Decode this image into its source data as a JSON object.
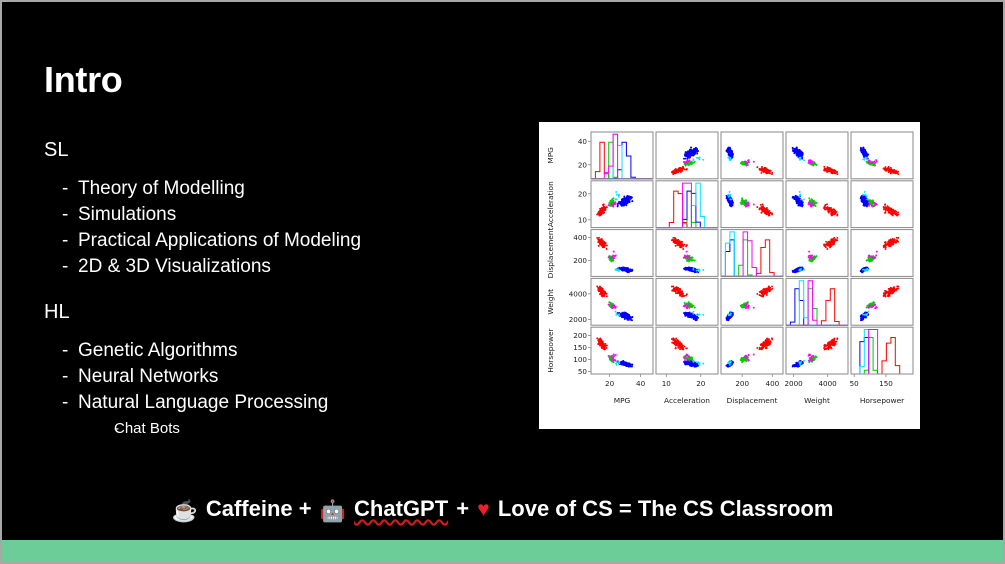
{
  "slide": {
    "title": "Intro",
    "background_color": "#000000",
    "text_color": "#ffffff",
    "accent_strip_color": "#6ccd99",
    "border_color": "#a8a8a8"
  },
  "sections": [
    {
      "label": "SL",
      "items": [
        "Theory of Modelling",
        "Simulations",
        "Practical Applications of Modeling",
        "2D & 3D Visualizations"
      ]
    },
    {
      "label": "HL",
      "items": [
        "Genetic Algorithms",
        "Neural Networks",
        "Natural Language Processing"
      ],
      "sub_items": [
        "Chat Bots"
      ]
    }
  ],
  "bullet_marker": "-",
  "footer": {
    "coffee_emoji": "☕",
    "text_1": "Caffeine +",
    "robot_emoji": "🤖",
    "text_2": "ChatGPT",
    "text_3": "+",
    "heart": "♥",
    "text_4": "Love of CS = The CS Classroom",
    "heart_color": "#e8222a",
    "spellcheck_underline_color": "#d21b1b"
  },
  "chart_data": {
    "type": "scatter",
    "title": "",
    "subtype": "scatter-plot-matrix",
    "variables": [
      "MPG",
      "Acceleration",
      "Displacement",
      "Weight",
      "Horsepower"
    ],
    "row_labels": [
      "MPG",
      "Acceleration",
      "Displacement",
      "Weight",
      "Horsepower"
    ],
    "column_labels": [
      "MPG",
      "Acceleration",
      "Displacement",
      "Weight",
      "Horsepower"
    ],
    "diagonal": "histogram",
    "grid": false,
    "legend": "none",
    "group_colors": [
      "#ff0000",
      "#00cc00",
      "#0000ff",
      "#00e5ff",
      "#ff00ff"
    ],
    "group_names": [
      "red-group",
      "green-group",
      "blue-group",
      "cyan-group",
      "magenta-group"
    ],
    "axes": [
      {
        "name": "MPG",
        "ticks": [
          20,
          40
        ],
        "range": [
          8,
          48
        ]
      },
      {
        "name": "Acceleration",
        "ticks": [
          10,
          20
        ],
        "range": [
          7,
          25
        ]
      },
      {
        "name": "Displacement",
        "ticks": [
          200,
          400
        ],
        "range": [
          60,
          470
        ]
      },
      {
        "name": "Weight",
        "ticks": [
          2000,
          4000
        ],
        "range": [
          1550,
          5200
        ]
      },
      {
        "name": "Horsepower",
        "ticks": [
          50,
          150
        ],
        "range": [
          40,
          235
        ]
      }
    ],
    "row_axis_ticks": [
      {
        "name": "MPG",
        "ticks": [
          20,
          40
        ]
      },
      {
        "name": "Acceleration",
        "ticks": [
          10,
          20
        ]
      },
      {
        "name": "Displacement",
        "ticks": [
          200,
          400
        ]
      },
      {
        "name": "Weight",
        "ticks": [
          2000,
          4000
        ]
      },
      {
        "name": "Horsepower",
        "ticks": [
          50,
          100,
          150,
          200
        ]
      }
    ],
    "relationships": [
      {
        "x": "MPG",
        "y": "Displacement",
        "trend": "negative"
      },
      {
        "x": "MPG",
        "y": "Weight",
        "trend": "negative"
      },
      {
        "x": "MPG",
        "y": "Horsepower",
        "trend": "negative"
      },
      {
        "x": "MPG",
        "y": "Acceleration",
        "trend": "positive"
      },
      {
        "x": "Displacement",
        "y": "Weight",
        "trend": "positive"
      },
      {
        "x": "Displacement",
        "y": "Horsepower",
        "trend": "positive"
      },
      {
        "x": "Weight",
        "y": "Horsepower",
        "trend": "positive"
      },
      {
        "x": "Acceleration",
        "y": "Horsepower",
        "trend": "negative"
      }
    ]
  }
}
